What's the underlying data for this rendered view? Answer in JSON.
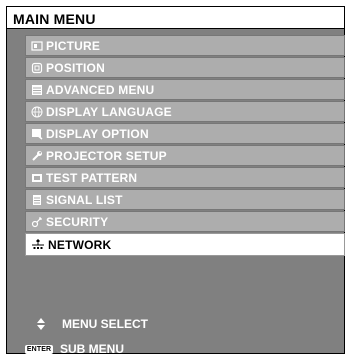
{
  "title": "MAIN MENU",
  "menu": [
    {
      "label": "PICTURE",
      "icon": "picture-icon",
      "active": false
    },
    {
      "label": "POSITION",
      "icon": "position-icon",
      "active": false
    },
    {
      "label": "ADVANCED MENU",
      "icon": "advanced-menu-icon",
      "active": false
    },
    {
      "label": "DISPLAY LANGUAGE",
      "icon": "globe-icon",
      "active": false
    },
    {
      "label": "DISPLAY OPTION",
      "icon": "display-option-icon",
      "active": false
    },
    {
      "label": "PROJECTOR SETUP",
      "icon": "wrench-icon",
      "active": false
    },
    {
      "label": "TEST PATTERN",
      "icon": "test-pattern-icon",
      "active": false
    },
    {
      "label": "SIGNAL LIST",
      "icon": "signal-list-icon",
      "active": false
    },
    {
      "label": "SECURITY",
      "icon": "key-icon",
      "active": false
    },
    {
      "label": "NETWORK",
      "icon": "network-icon",
      "active": true
    }
  ],
  "footer": {
    "select_label": "MENU SELECT",
    "select_icon": "up-down-arrows-icon",
    "enter_badge": "ENTER",
    "sub_label": "SUB MENU"
  },
  "colors": {
    "panel": "#808080",
    "item": "#adadad",
    "active_item": "#ffffff",
    "item_text": "#ffffff"
  }
}
